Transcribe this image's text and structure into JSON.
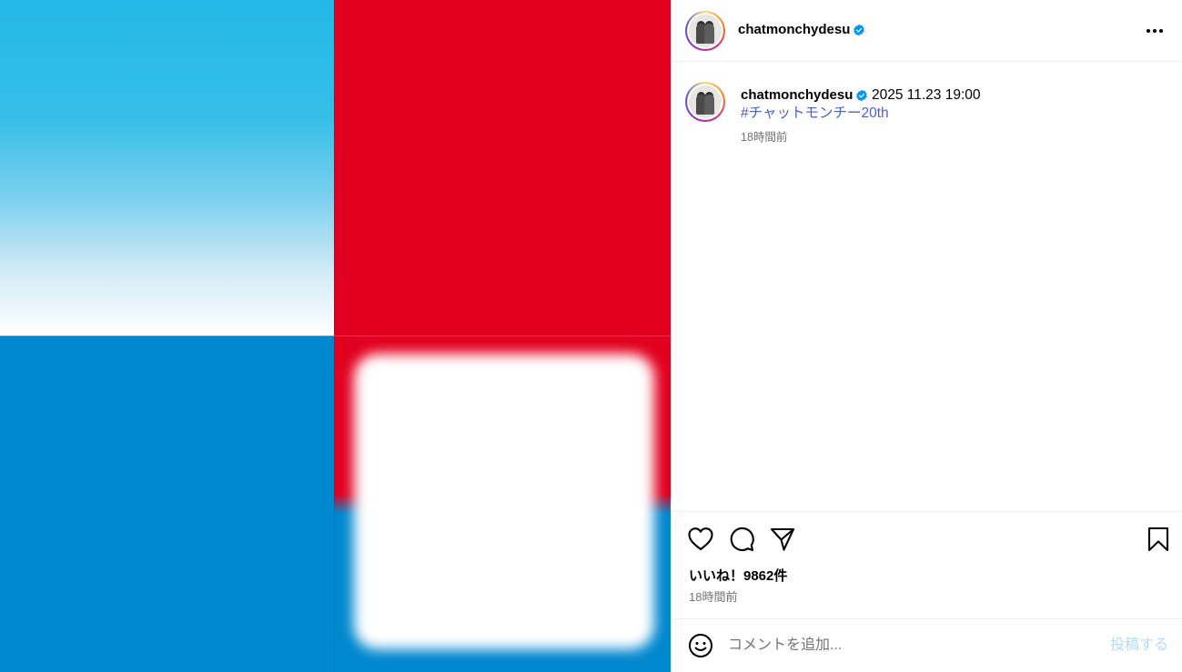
{
  "post": {
    "username": "chatmonchydesu",
    "verified_icon": "verified-badge-icon",
    "caption_text": "2025 11.23 19:00",
    "hashtag": "#チャットモンチー20th",
    "caption_time": "18時間前"
  },
  "actions": {
    "likes": "いいね！9862件",
    "posted_time": "18時間前"
  },
  "comment": {
    "placeholder": "コメントを追加...",
    "post_label": "投稿する"
  },
  "colors": {
    "brand_red": "#e10020",
    "brand_blue": "#0088cf",
    "sky_blue": "#23b8e6",
    "link_blue": "#4a5fd1",
    "verified_blue": "#0095f6",
    "post_button_disabled": "#b3dbff"
  }
}
